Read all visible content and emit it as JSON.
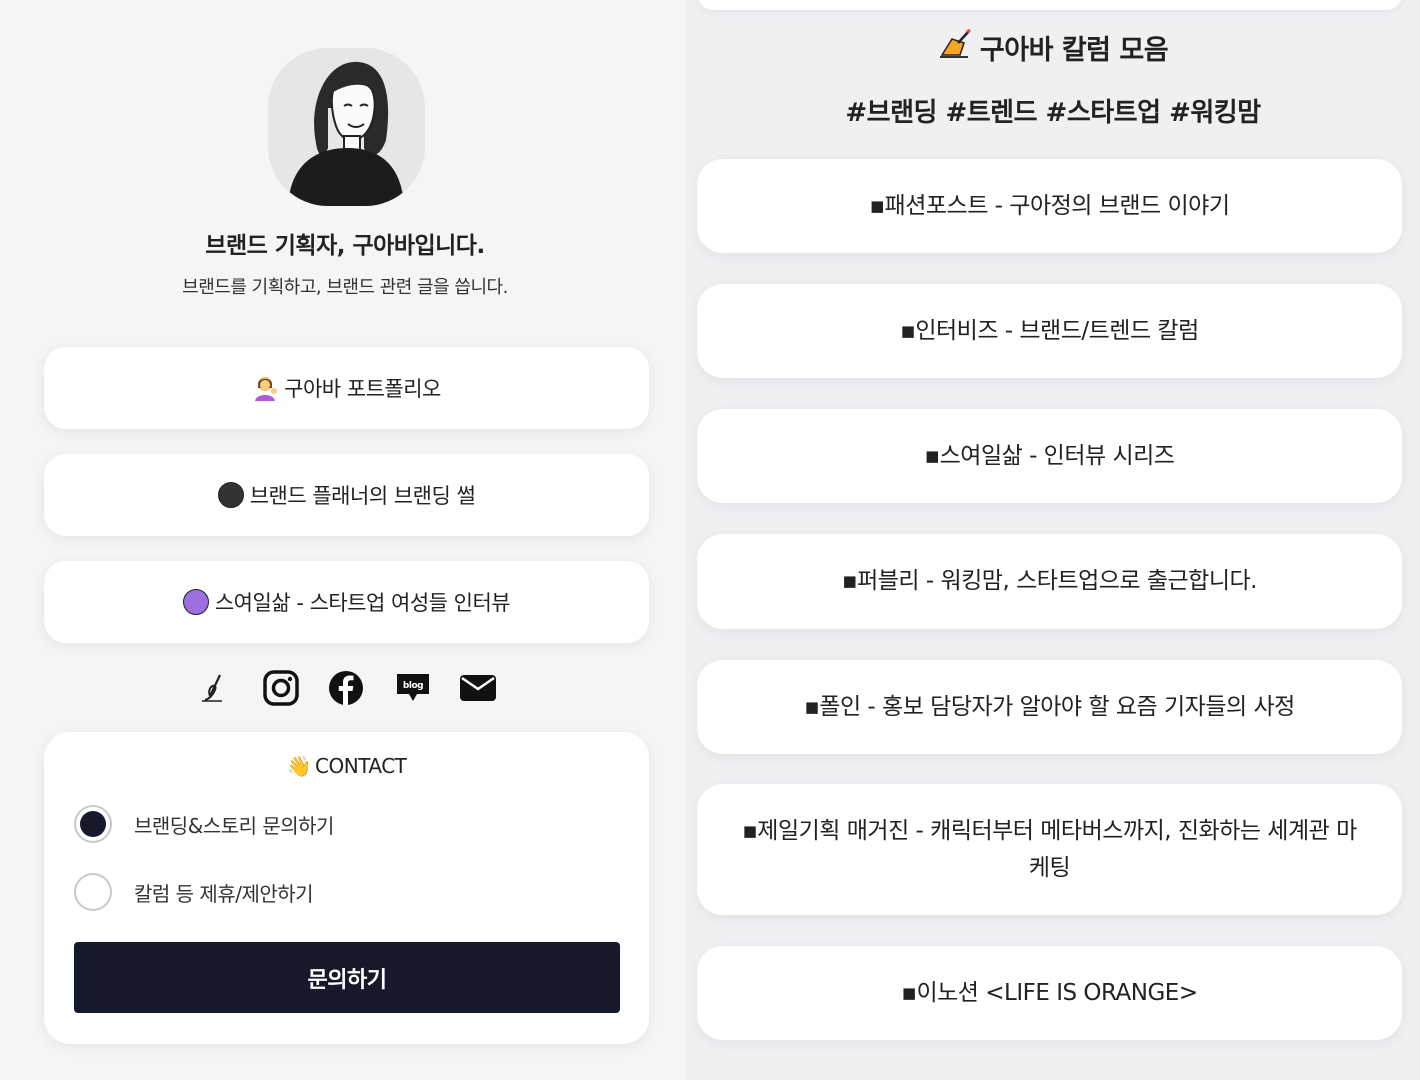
{
  "profile": {
    "name": "브랜드 기획자, 구아바입니다.",
    "bio": "브랜드를 기획하고, 브랜드 관련 글을 씁니다."
  },
  "left_links": [
    {
      "icon": "person-tipping-hand-emoji",
      "label": "구아바 포트폴리오"
    },
    {
      "icon": "black-circle-emoji",
      "label": "브랜드 플래너의 브랜딩 썰",
      "color": "#333333"
    },
    {
      "icon": "purple-circle-emoji",
      "label": "스여일삶 - 스타트업 여성들 인터뷰",
      "color": "#9b6fe0"
    }
  ],
  "socials": [
    {
      "icon": "brunch-pen-icon"
    },
    {
      "icon": "instagram-icon"
    },
    {
      "icon": "facebook-icon"
    },
    {
      "icon": "blog-icon",
      "text": "blog"
    },
    {
      "icon": "mail-icon"
    }
  ],
  "contact": {
    "title_emoji": "👋",
    "title": "CONTACT",
    "options": [
      {
        "label": "브랜딩&스토리 문의하기",
        "selected": true
      },
      {
        "label": "칼럼 등 제휴/제안하기",
        "selected": false
      }
    ],
    "submit_label": "문의하기"
  },
  "column": {
    "title_emoji": "✍️",
    "title": "구아바 칼럼 모음",
    "tags": "#브랜딩 #트렌드 #스타트업 #워킹맘",
    "links": [
      "▪패션포스트 - 구아정의 브랜드 이야기",
      "▪인터비즈 - 브랜드/트렌드 칼럼",
      "▪스여일삶 - 인터뷰 시리즈",
      "▪퍼블리 - 워킹맘, 스타트업으로 출근합니다.",
      "▪폴인 - 홍보 담당자가 알아야 할 요즘 기자들의 사정",
      "▪제일기획 매거진 - 캐릭터부터 메타버스까지, 진화하는 세계관 마케팅",
      "▪이노션 <LIFE IS ORANGE>"
    ]
  },
  "colors": {
    "background": "#f5f5f7",
    "card": "#ffffff",
    "primary_button": "#15192a"
  }
}
